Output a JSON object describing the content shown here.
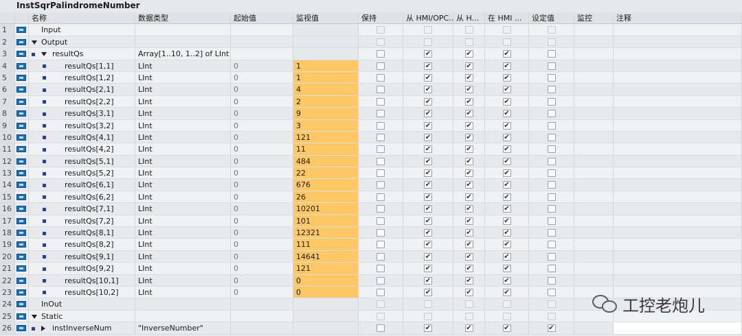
{
  "block_title": "InstSqrPalindromeNumber",
  "columns": {
    "name": "名称",
    "data_type": "数据类型",
    "start_value": "起始值",
    "monitor_value": "监视值",
    "retain": "保持",
    "hmi_access": "从 HMI/OPC...",
    "hmi_write": "从 H...",
    "hmi_visible": "在 HMI ...",
    "setpoint": "设定值",
    "supervision": "监控",
    "comment": "注释"
  },
  "rows": [
    {
      "num": "1",
      "level": 0,
      "marker": "",
      "expander": "",
      "name": "Input",
      "type": "",
      "start": "",
      "monitor": "",
      "hl": false,
      "cb": [
        0,
        0,
        0,
        0,
        0
      ],
      "dim": true
    },
    {
      "num": "2",
      "level": 0,
      "marker": "",
      "expander": "down",
      "name": "Output",
      "type": "",
      "start": "",
      "monitor": "",
      "hl": false,
      "cb": [
        0,
        0,
        0,
        0,
        0
      ],
      "dim": true
    },
    {
      "num": "3",
      "level": 1,
      "marker": "sq",
      "expander": "down",
      "name": "resultQs",
      "type": "Array[1..10, 1..2] of LInt",
      "start": "",
      "monitor": "",
      "hl": false,
      "cb": [
        0,
        1,
        1,
        1,
        0
      ],
      "dim": false
    },
    {
      "num": "4",
      "level": 2,
      "marker": "sq",
      "expander": "",
      "name": "resultQs[1,1]",
      "type": "LInt",
      "start": "0",
      "monitor": "1",
      "hl": true,
      "cb": [
        0,
        1,
        1,
        1,
        0
      ],
      "dim": false
    },
    {
      "num": "5",
      "level": 2,
      "marker": "sq",
      "expander": "",
      "name": "resultQs[1,2]",
      "type": "LInt",
      "start": "0",
      "monitor": "1",
      "hl": true,
      "cb": [
        0,
        1,
        1,
        1,
        0
      ],
      "dim": false
    },
    {
      "num": "6",
      "level": 2,
      "marker": "sq",
      "expander": "",
      "name": "resultQs[2,1]",
      "type": "LInt",
      "start": "0",
      "monitor": "4",
      "hl": true,
      "cb": [
        0,
        1,
        1,
        1,
        0
      ],
      "dim": false
    },
    {
      "num": "7",
      "level": 2,
      "marker": "sq",
      "expander": "",
      "name": "resultQs[2,2]",
      "type": "LInt",
      "start": "0",
      "monitor": "2",
      "hl": true,
      "cb": [
        0,
        1,
        1,
        1,
        0
      ],
      "dim": false
    },
    {
      "num": "8",
      "level": 2,
      "marker": "sq",
      "expander": "",
      "name": "resultQs[3,1]",
      "type": "LInt",
      "start": "0",
      "monitor": "9",
      "hl": true,
      "cb": [
        0,
        1,
        1,
        1,
        0
      ],
      "dim": false
    },
    {
      "num": "9",
      "level": 2,
      "marker": "sq",
      "expander": "",
      "name": "resultQs[3,2]",
      "type": "LInt",
      "start": "0",
      "monitor": "3",
      "hl": true,
      "cb": [
        0,
        1,
        1,
        1,
        0
      ],
      "dim": false
    },
    {
      "num": "10",
      "level": 2,
      "marker": "sq",
      "expander": "",
      "name": "resultQs[4,1]",
      "type": "LInt",
      "start": "0",
      "monitor": "121",
      "hl": true,
      "cb": [
        0,
        1,
        1,
        1,
        0
      ],
      "dim": false
    },
    {
      "num": "11",
      "level": 2,
      "marker": "sq",
      "expander": "",
      "name": "resultQs[4,2]",
      "type": "LInt",
      "start": "0",
      "monitor": "11",
      "hl": true,
      "cb": [
        0,
        1,
        1,
        1,
        0
      ],
      "dim": false
    },
    {
      "num": "12",
      "level": 2,
      "marker": "sq",
      "expander": "",
      "name": "resultQs[5,1]",
      "type": "LInt",
      "start": "0",
      "monitor": "484",
      "hl": true,
      "cb": [
        0,
        1,
        1,
        1,
        0
      ],
      "dim": false
    },
    {
      "num": "13",
      "level": 2,
      "marker": "sq",
      "expander": "",
      "name": "resultQs[5,2]",
      "type": "LInt",
      "start": "0",
      "monitor": "22",
      "hl": true,
      "cb": [
        0,
        1,
        1,
        1,
        0
      ],
      "dim": false
    },
    {
      "num": "14",
      "level": 2,
      "marker": "sq",
      "expander": "",
      "name": "resultQs[6,1]",
      "type": "LInt",
      "start": "0",
      "monitor": "676",
      "hl": true,
      "cb": [
        0,
        1,
        1,
        1,
        0
      ],
      "dim": false
    },
    {
      "num": "15",
      "level": 2,
      "marker": "sq",
      "expander": "",
      "name": "resultQs[6,2]",
      "type": "LInt",
      "start": "0",
      "monitor": "26",
      "hl": true,
      "cb": [
        0,
        1,
        1,
        1,
        0
      ],
      "dim": false
    },
    {
      "num": "16",
      "level": 2,
      "marker": "sq",
      "expander": "",
      "name": "resultQs[7,1]",
      "type": "LInt",
      "start": "0",
      "monitor": "10201",
      "hl": true,
      "cb": [
        0,
        1,
        1,
        1,
        0
      ],
      "dim": false
    },
    {
      "num": "17",
      "level": 2,
      "marker": "sq",
      "expander": "",
      "name": "resultQs[7,2]",
      "type": "LInt",
      "start": "0",
      "monitor": "101",
      "hl": true,
      "cb": [
        0,
        1,
        1,
        1,
        0
      ],
      "dim": false
    },
    {
      "num": "18",
      "level": 2,
      "marker": "sq",
      "expander": "",
      "name": "resultQs[8,1]",
      "type": "LInt",
      "start": "0",
      "monitor": "12321",
      "hl": true,
      "cb": [
        0,
        1,
        1,
        1,
        0
      ],
      "dim": false
    },
    {
      "num": "19",
      "level": 2,
      "marker": "sq",
      "expander": "",
      "name": "resultQs[8,2]",
      "type": "LInt",
      "start": "0",
      "monitor": "111",
      "hl": true,
      "cb": [
        0,
        1,
        1,
        1,
        0
      ],
      "dim": false
    },
    {
      "num": "20",
      "level": 2,
      "marker": "sq",
      "expander": "",
      "name": "resultQs[9,1]",
      "type": "LInt",
      "start": "0",
      "monitor": "14641",
      "hl": true,
      "cb": [
        0,
        1,
        1,
        1,
        0
      ],
      "dim": false
    },
    {
      "num": "21",
      "level": 2,
      "marker": "sq",
      "expander": "",
      "name": "resultQs[9,2]",
      "type": "LInt",
      "start": "0",
      "monitor": "121",
      "hl": true,
      "cb": [
        0,
        1,
        1,
        1,
        0
      ],
      "dim": false
    },
    {
      "num": "22",
      "level": 2,
      "marker": "sq",
      "expander": "",
      "name": "resultQs[10,1]",
      "type": "LInt",
      "start": "0",
      "monitor": "0",
      "hl": true,
      "cb": [
        0,
        1,
        1,
        1,
        0
      ],
      "dim": false
    },
    {
      "num": "23",
      "level": 2,
      "marker": "sq",
      "expander": "",
      "name": "resultQs[10,2]",
      "type": "LInt",
      "start": "0",
      "monitor": "0",
      "hl": true,
      "cb": [
        0,
        1,
        1,
        1,
        0
      ],
      "dim": false
    },
    {
      "num": "24",
      "level": 0,
      "marker": "",
      "expander": "",
      "name": "InOut",
      "type": "",
      "start": "",
      "monitor": "",
      "hl": false,
      "cb": [
        0,
        0,
        0,
        0,
        0
      ],
      "dim": true
    },
    {
      "num": "25",
      "level": 0,
      "marker": "",
      "expander": "down",
      "name": "Static",
      "type": "",
      "start": "",
      "monitor": "",
      "hl": false,
      "cb": [
        0,
        0,
        0,
        0,
        0
      ],
      "dim": true
    },
    {
      "num": "26",
      "level": 1,
      "marker": "sq",
      "expander": "right",
      "name": "instInverseNum",
      "type": "\"InverseNumber\"",
      "start": "",
      "monitor": "",
      "hl": false,
      "cb": [
        0,
        1,
        1,
        1,
        1
      ],
      "dim": false
    }
  ],
  "watermark": {
    "text": "工控老炮儿",
    "icon": "wechat-icon"
  },
  "colors": {
    "monitor_highlight": "#ffc864",
    "db_icon": "#1e6fb8"
  }
}
